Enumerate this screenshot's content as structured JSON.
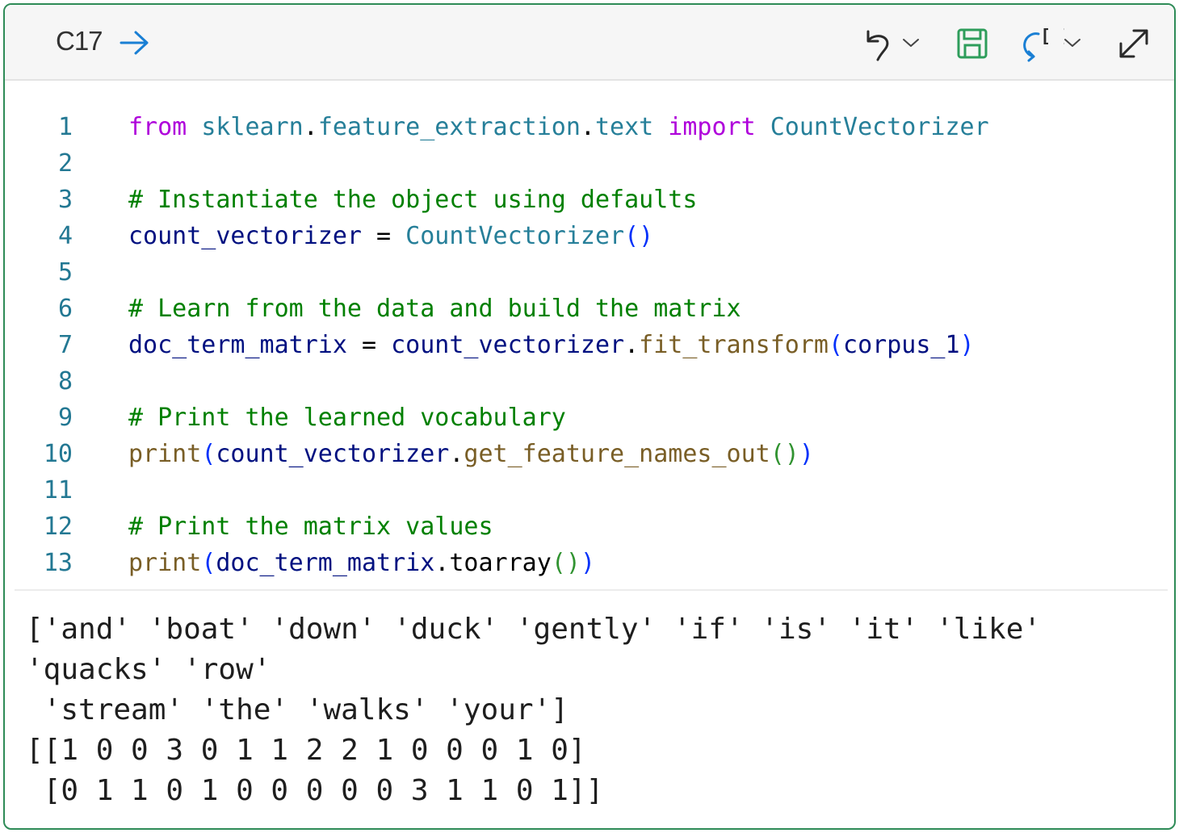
{
  "toolbar": {
    "cell_reference": "C17",
    "icons": {
      "go": "arrow-right-icon",
      "undo": "undo-icon",
      "undo_menu": "chevron-down-icon",
      "save": "save-icon",
      "refresh": "refresh-brackets-icon",
      "refresh_menu": "chevron-down-icon",
      "expand": "expand-icon"
    },
    "colors": {
      "accent": "#2e8b57",
      "link": "#1a7fd4"
    }
  },
  "code": {
    "line_numbers": [
      "1",
      "2",
      "3",
      "4",
      "5",
      "6",
      "7",
      "8",
      "9",
      "10",
      "11",
      "12",
      "13"
    ],
    "lines": [
      [
        {
          "t": "from",
          "c": "kw"
        },
        {
          "t": " ",
          "c": "plain"
        },
        {
          "t": "sklearn",
          "c": "mod"
        },
        {
          "t": ".",
          "c": "plain"
        },
        {
          "t": "feature_extraction",
          "c": "mod"
        },
        {
          "t": ".",
          "c": "plain"
        },
        {
          "t": "text",
          "c": "mod"
        },
        {
          "t": " ",
          "c": "plain"
        },
        {
          "t": "import",
          "c": "kw"
        },
        {
          "t": " ",
          "c": "plain"
        },
        {
          "t": "CountVectorizer",
          "c": "cls"
        }
      ],
      [],
      [
        {
          "t": "# Instantiate the object using defaults",
          "c": "cmt"
        }
      ],
      [
        {
          "t": "count_vectorizer",
          "c": "var"
        },
        {
          "t": " = ",
          "c": "plain"
        },
        {
          "t": "CountVectorizer",
          "c": "cls"
        },
        {
          "t": "()",
          "c": "p1"
        }
      ],
      [],
      [
        {
          "t": "# Learn from the data and build the matrix",
          "c": "cmt"
        }
      ],
      [
        {
          "t": "doc_term_matrix",
          "c": "var"
        },
        {
          "t": " = ",
          "c": "plain"
        },
        {
          "t": "count_vectorizer",
          "c": "var"
        },
        {
          "t": ".",
          "c": "plain"
        },
        {
          "t": "fit_transform",
          "c": "fn"
        },
        {
          "t": "(",
          "c": "p1"
        },
        {
          "t": "corpus_1",
          "c": "var"
        },
        {
          "t": ")",
          "c": "p1"
        }
      ],
      [],
      [
        {
          "t": "# Print the learned vocabulary",
          "c": "cmt"
        }
      ],
      [
        {
          "t": "print",
          "c": "fn"
        },
        {
          "t": "(",
          "c": "p1"
        },
        {
          "t": "count_vectorizer",
          "c": "var"
        },
        {
          "t": ".",
          "c": "plain"
        },
        {
          "t": "get_feature_names_out",
          "c": "fn"
        },
        {
          "t": "()",
          "c": "p2"
        },
        {
          "t": ")",
          "c": "p1"
        }
      ],
      [],
      [
        {
          "t": "# Print the matrix values",
          "c": "cmt"
        }
      ],
      [
        {
          "t": "print",
          "c": "fn"
        },
        {
          "t": "(",
          "c": "p1"
        },
        {
          "t": "doc_term_matrix",
          "c": "var"
        },
        {
          "t": ".",
          "c": "plain"
        },
        {
          "t": "toarray",
          "c": "plain"
        },
        {
          "t": "()",
          "c": "p2"
        },
        {
          "t": ")",
          "c": "p1"
        }
      ]
    ]
  },
  "output": {
    "lines": [
      "['and' 'boat' 'down' 'duck' 'gently' 'if' 'is' 'it' 'like'",
      "'quacks' 'row'",
      " 'stream' 'the' 'walks' 'your']",
      "[[1 0 0 3 0 1 1 2 2 1 0 0 0 1 0]",
      " [0 1 1 0 1 0 0 0 0 0 3 1 1 0 1]]"
    ]
  }
}
